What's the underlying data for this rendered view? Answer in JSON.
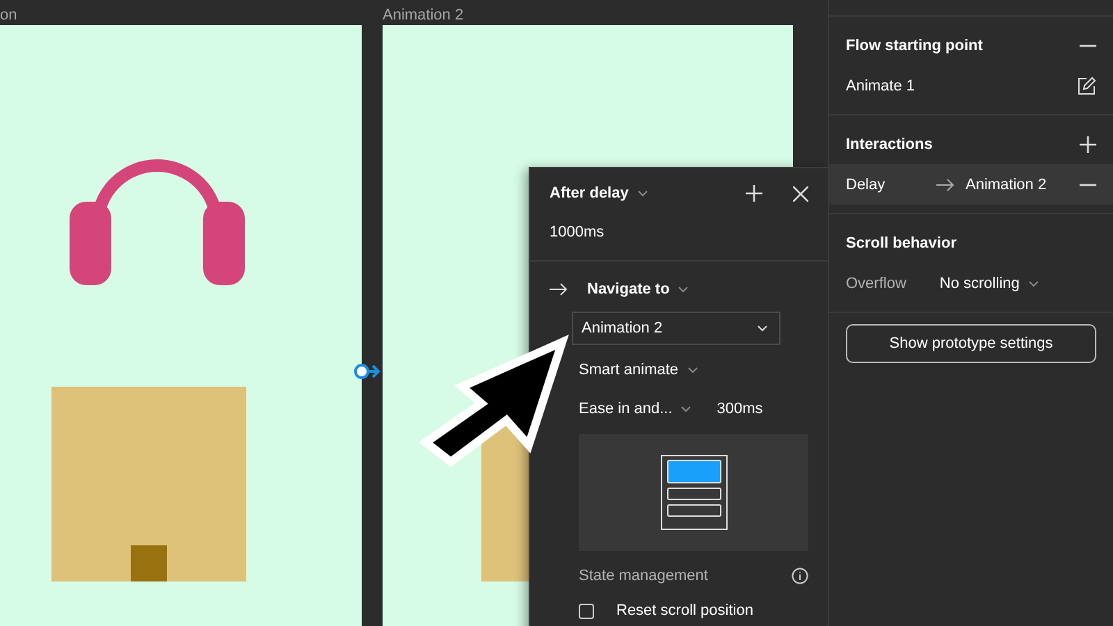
{
  "canvas": {
    "frames": [
      {
        "label": "on"
      },
      {
        "label": "Animation 2"
      }
    ]
  },
  "interaction_popup": {
    "trigger": "After delay",
    "delay": "1000ms",
    "action": "Navigate to",
    "destination": "Animation 2",
    "animation": "Smart animate",
    "easing": "Ease in and...",
    "duration": "300ms",
    "state_management": "State management",
    "reset_scroll": {
      "label": "Reset scroll position",
      "checked": false
    }
  },
  "panel": {
    "flow_starting_point": {
      "title": "Flow starting point",
      "value": "Animate 1"
    },
    "interactions": {
      "title": "Interactions",
      "rows": [
        {
          "trigger": "Delay",
          "destination": "Animation 2",
          "selected": true
        }
      ]
    },
    "scroll_behavior": {
      "title": "Scroll behavior",
      "label": "Overflow",
      "value": "No scrolling"
    },
    "button": "Show prototype settings"
  }
}
